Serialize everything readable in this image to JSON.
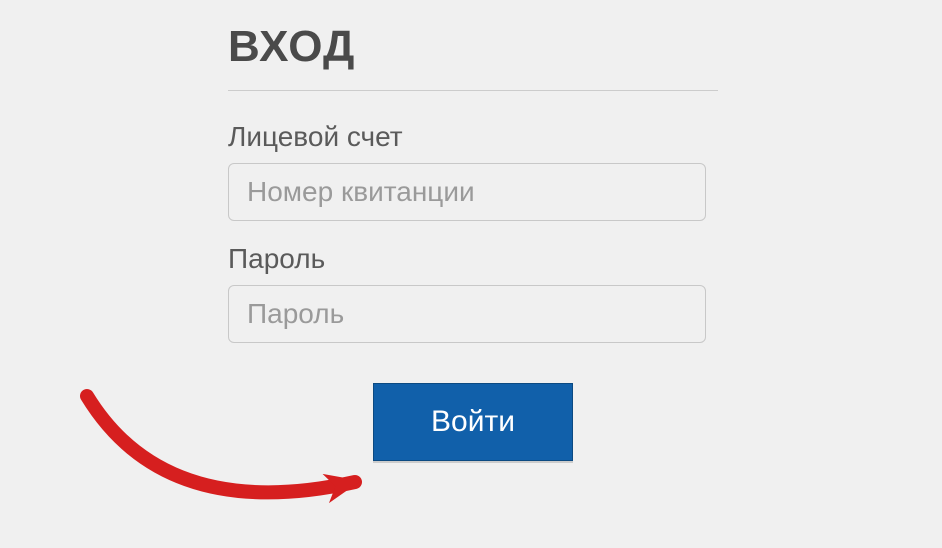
{
  "login": {
    "title": "ВХОД",
    "account_label": "Лицевой счет",
    "account_placeholder": "Номер квитанции",
    "password_label": "Пароль",
    "password_placeholder": "Пароль",
    "submit_label": "Войти"
  },
  "colors": {
    "button_bg": "#1160aa",
    "button_text": "#ffffff",
    "arrow": "#d61f1f"
  }
}
